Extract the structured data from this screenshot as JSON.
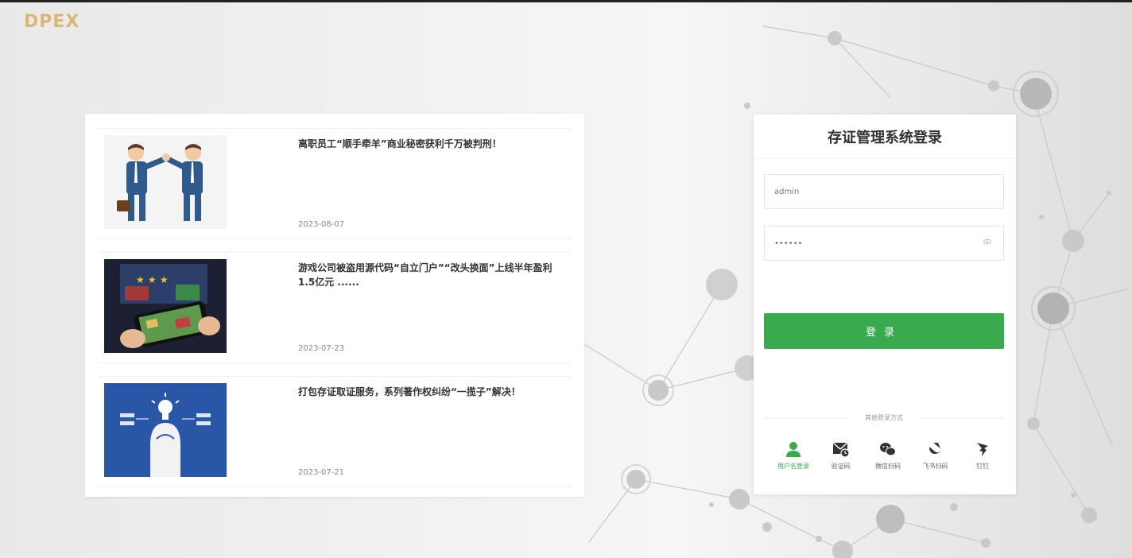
{
  "logo": "DPEX",
  "news": [
    {
      "title": "离职员工“顺手牵羊”商业秘密获利千万被判刑！",
      "date": "2023-08-07",
      "thumb": "handshake-image"
    },
    {
      "title": "游戏公司被盗用源代码“自立门户”“改头换面”上线半年盈利1.5亿元 ......",
      "date": "2023-07-23",
      "thumb": "mobile-game-image"
    },
    {
      "title": "打包存证取证服务，系列著作权纠纷“一揽子”解决！",
      "date": "2023-07-21",
      "thumb": "lightbulb-head-image"
    }
  ],
  "login": {
    "title": "存证管理系统登录",
    "username_value": "admin",
    "password_value": "••••••",
    "submit_label": "登录",
    "other_methods_label": "其他登录方式",
    "methods": [
      {
        "label": "用户名登录",
        "icon": "user-icon",
        "active": true
      },
      {
        "label": "验证码",
        "icon": "sms-code-icon",
        "active": false
      },
      {
        "label": "微信扫码",
        "icon": "wechat-icon",
        "active": false
      },
      {
        "label": "飞书扫码",
        "icon": "feishu-icon",
        "active": false
      },
      {
        "label": "钉钉",
        "icon": "dingtalk-icon",
        "active": false
      }
    ]
  },
  "colors": {
    "accent": "#3aaa4f",
    "logo": "#d8b873"
  }
}
